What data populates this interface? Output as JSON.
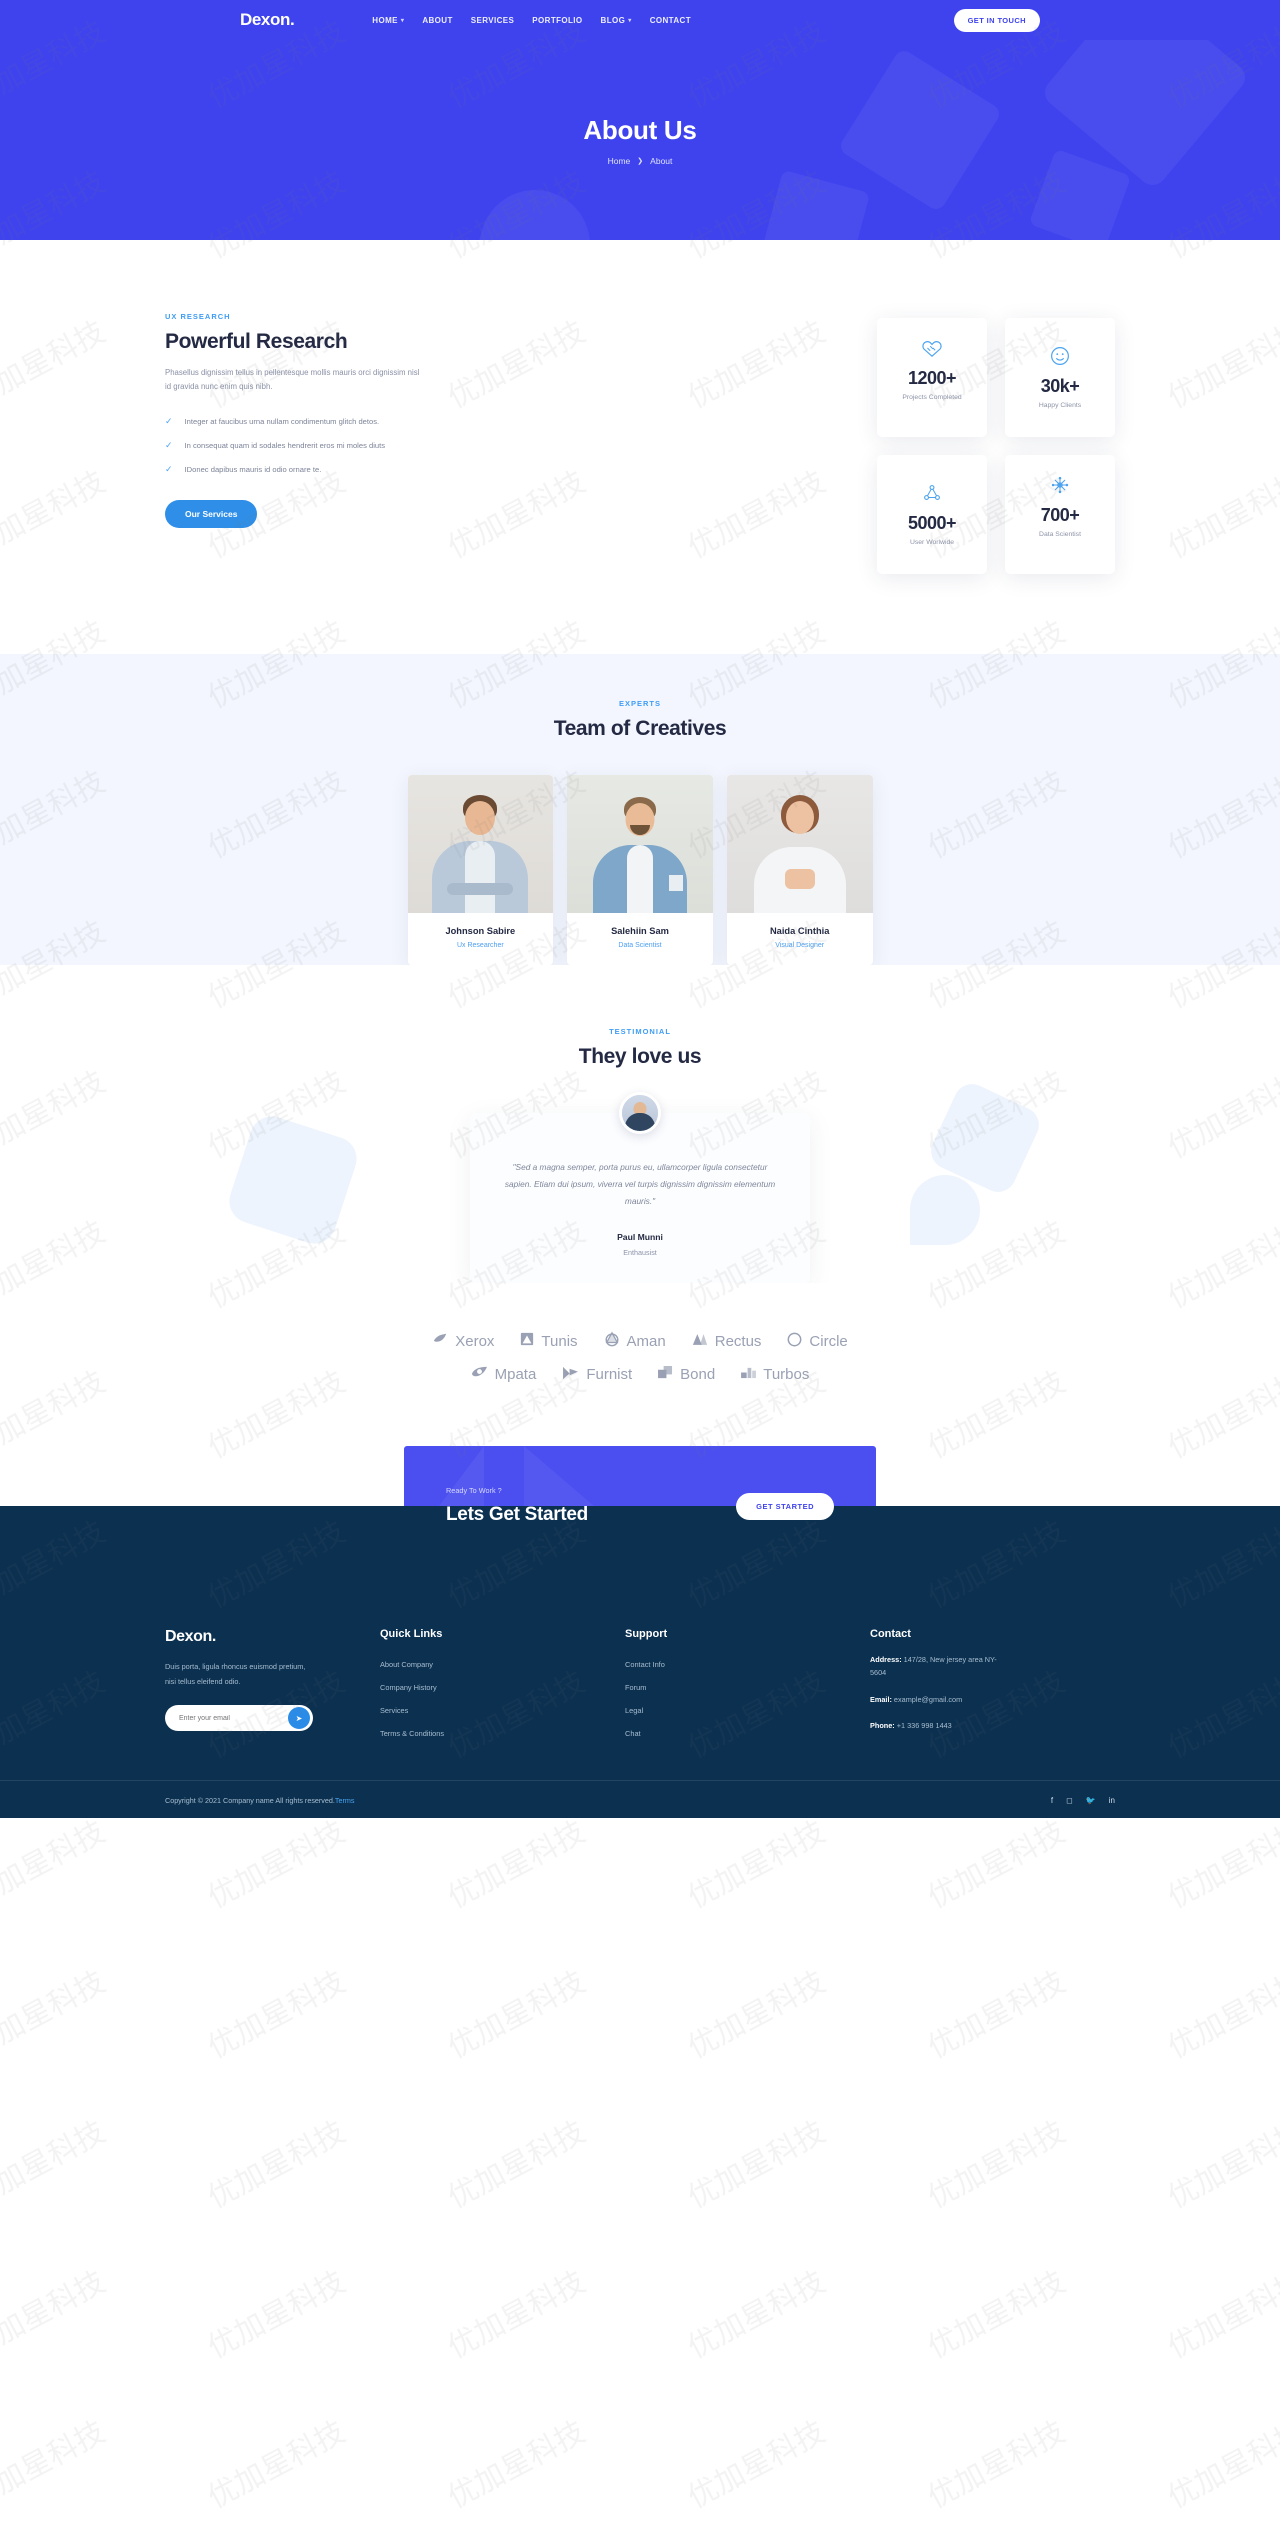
{
  "brand": {
    "name": "Dexon.",
    "accent": "#3f43ee",
    "accent_blue": "#2f8fe8",
    "footer_bg": "#0b3050"
  },
  "nav": {
    "items": [
      {
        "label": "HOME",
        "caret": true
      },
      {
        "label": "ABOUT",
        "caret": false
      },
      {
        "label": "SERVICES",
        "caret": false
      },
      {
        "label": "PORTFOLIO",
        "caret": false
      },
      {
        "label": "BLOG",
        "caret": true
      },
      {
        "label": "CONTACT",
        "caret": false
      }
    ],
    "cta": "GET IN TOUCH"
  },
  "hero": {
    "title": "About Us",
    "crumb_home": "Home",
    "crumb_sep": "❯",
    "crumb_current": "About"
  },
  "research": {
    "eyebrow": "UX RESEARCH",
    "title": "Powerful Research",
    "paragraph": "Phasellus dignissim tellus in pellentesque mollis mauris orci dignissim nisl id gravida nunc enim quis nibh.",
    "checks": [
      "Integer at faucibus urna nullam condimentum glitch detos.",
      "In consequat quam id sodales hendrerit eros mi moles diuts",
      "IDonec dapibus mauris id odio ornare te."
    ],
    "button": "Our Services",
    "stats": [
      {
        "icon": "handshake-heart-icon",
        "number": "1200+",
        "label": "Projects Completed"
      },
      {
        "icon": "smiley-face-icon",
        "number": "30k+",
        "label": "Happy Clients"
      },
      {
        "icon": "network-nodes-icon",
        "number": "5000+",
        "label": "User Worlwide"
      },
      {
        "icon": "data-molecule-icon",
        "number": "700+",
        "label": "Data Scientist"
      }
    ]
  },
  "team": {
    "eyebrow": "EXPERTS",
    "title": "Team of Creatives",
    "members": [
      {
        "name": "Johnson Sabire",
        "role": "Ux Researcher"
      },
      {
        "name": "Salehiin Sam",
        "role": "Data Scientist"
      },
      {
        "name": "Naida Cinthia",
        "role": "Visual Designer"
      }
    ]
  },
  "testimonial": {
    "eyebrow": "TESTIMONIAL",
    "title": "They love us",
    "quote": "\"Sed a magna semper, porta purus eu, ullamcorper ligula consectetur sapien. Etiam dui ipsum, viverra vel turpis dignissim dignissim elementum mauris.\"",
    "author": "Paul Munni",
    "author_role": "Enthausist"
  },
  "brands": {
    "row1": [
      {
        "name": "Xerox",
        "icon": "leaf-dot-icon"
      },
      {
        "name": "Tunis",
        "icon": "square-triangle-icon"
      },
      {
        "name": "Aman",
        "icon": "circle-triangle-icon"
      },
      {
        "name": "Rectus",
        "icon": "split-triangle-icon"
      },
      {
        "name": "Circle",
        "icon": "ring-icon"
      }
    ],
    "row2": [
      {
        "name": "Mpata",
        "icon": "swirl-leaf-icon"
      },
      {
        "name": "Furnist",
        "icon": "flag-arrow-icon"
      },
      {
        "name": "Bond",
        "icon": "stacked-squares-icon"
      },
      {
        "name": "Turbos",
        "icon": "bars-icon"
      }
    ]
  },
  "cta": {
    "small": "Ready To Work ?",
    "title": "Lets Get Started",
    "button": "GET STARTED"
  },
  "footer": {
    "logo": "Dexon.",
    "description": "Duis porta, ligula rhoncus euismod pretium, nisi tellus eleifend odio.",
    "email_placeholder": "Enter your email",
    "email_value": "",
    "send_icon": "paper-plane-icon",
    "quick_links": {
      "heading": "Quick Links",
      "items": [
        "About Company",
        "Company History",
        "Services",
        "Terms & Conditions"
      ]
    },
    "support": {
      "heading": "Support",
      "items": [
        "Contact Info",
        "Forum",
        "Legal",
        "Chat"
      ]
    },
    "contact": {
      "heading": "Contact",
      "address_label": "Address:",
      "address_value": " 147/28, New jersey area NY-5604",
      "email_label": "Email:",
      "email_value": " example@gmail.com",
      "phone_label": "Phone:",
      "phone_value": " +1 336 998 1443"
    },
    "copyright_pre": "Copyright © 2021 Company name All rights reserved.",
    "copyright_link": "Terms",
    "socials": [
      "facebook-icon",
      "instagram-icon",
      "twitter-icon",
      "linkedin-icon"
    ]
  },
  "watermark": "优加星科技"
}
